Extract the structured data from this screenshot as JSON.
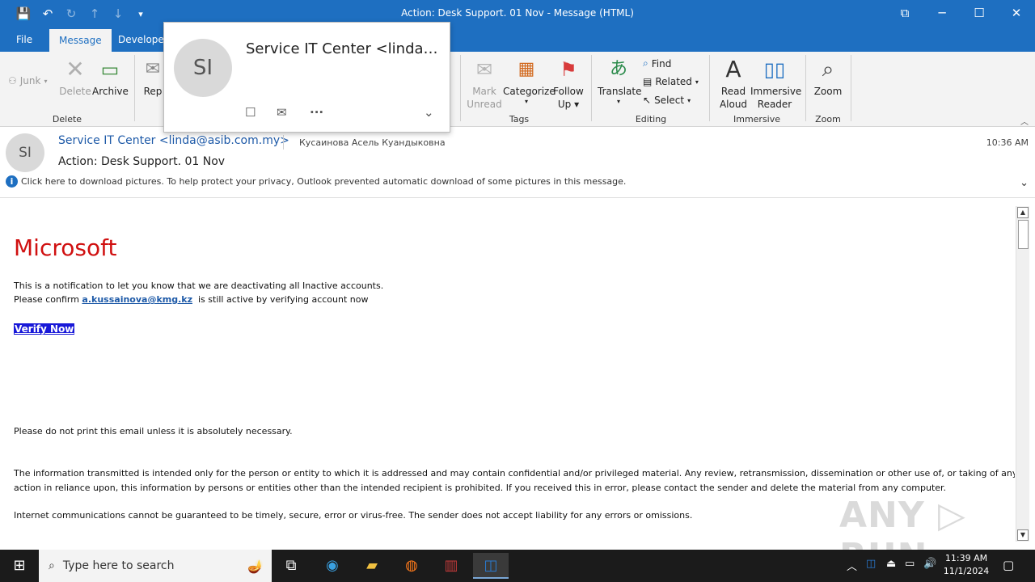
{
  "window": {
    "title": "Action: Desk Support. 01 Nov  -  Message (HTML)",
    "controls": {
      "restore": "⧉",
      "minimize": "─",
      "maximize": "☐",
      "close": "✕"
    }
  },
  "qat": {
    "save": "💾",
    "undo": "↶",
    "redo": "↻",
    "up": "↑",
    "down": "↓",
    "more": "▾"
  },
  "tabs": [
    {
      "label": "File"
    },
    {
      "label": "Message"
    },
    {
      "label": "Developer"
    }
  ],
  "ribbon": {
    "junk": "Junk",
    "delete": "Delete",
    "archive": "Archive",
    "reply": "Rep",
    "mark_unread_1": "Mark",
    "mark_unread_2": "Unread",
    "categorize": "Categorize",
    "follow_up_1": "Follow",
    "follow_up_2": "Up",
    "translate": "Translate",
    "find": "Find",
    "related": "Related",
    "select": "Select",
    "read_aloud_1": "Read",
    "read_aloud_2": "Aloud",
    "immersive_1": "Immersive",
    "immersive_2": "Reader",
    "zoom": "Zoom",
    "groups": {
      "delete": "Delete",
      "tags": "Tags",
      "editing": "Editing",
      "immersive": "Immersive",
      "zoom": "Zoom"
    }
  },
  "contact_card": {
    "initials": "SI",
    "name": "Service IT Center <linda@..."
  },
  "message": {
    "initials": "SI",
    "sender": "Service IT Center <linda@asib.com.my>",
    "recipient": "Кусаинова Асель Куандыковна",
    "time": "10:36 AM",
    "subject": "Action: Desk Support. 01 Nov",
    "info_icon": "i",
    "info": "Click here to download pictures. To help protect your privacy, Outlook prevented automatic download of some pictures in this message."
  },
  "body": {
    "brand": "Microsoft",
    "line1": "This is a notification to let you know that we are deactivating all Inactive accounts.",
    "line2_pre": "Please confirm ",
    "line2_link": "a.kussainova@kmg.kz",
    "line2_post": "  is still active by verifying account now",
    "verify": "Verify Now",
    "print_notice": "Please do not print this email unless it is absolutely necessary.",
    "disclaimer1": "The information transmitted is intended only for the person or entity to which it is addressed and may contain confidential and/or privileged material. Any review, retransmission, dissemination or other use of, or taking of any",
    "disclaimer2": "action in reliance upon, this information by persons or entities other than the intended recipient is prohibited. If you received this in error, please contact the sender and delete the material from any computer.",
    "disclaimer3": "Internet communications cannot be guaranteed to be timely, secure, error or virus-free. The sender does not accept liability for any errors or omissions."
  },
  "watermark": "ANY ▷ RUN",
  "taskbar": {
    "search_placeholder": "Type here to search",
    "time": "11:39 AM",
    "date": "11/1/2024"
  }
}
